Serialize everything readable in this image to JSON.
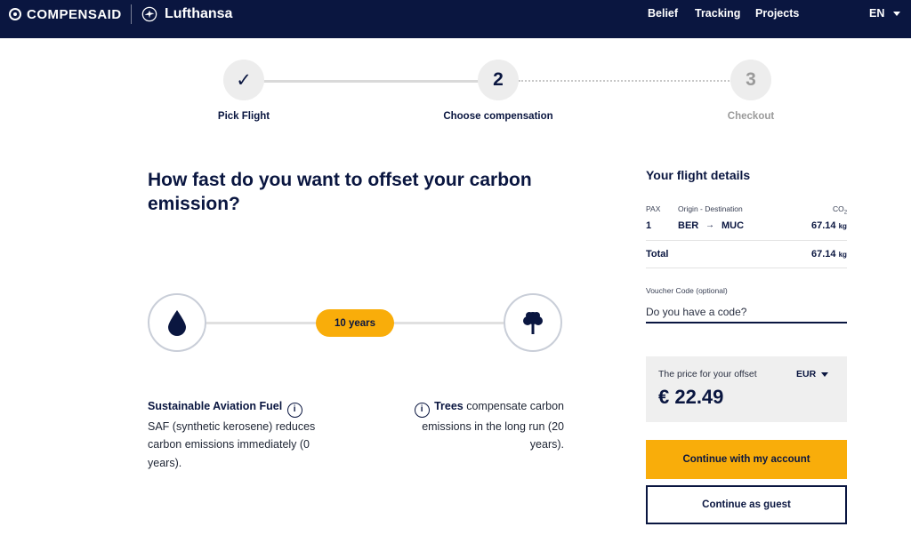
{
  "header": {
    "brand": "COMPENSAID",
    "partner": "Lufthansa",
    "nav": [
      "Belief",
      "Tracking",
      "Projects"
    ],
    "language": "EN"
  },
  "stepper": {
    "steps": [
      {
        "number": "✓",
        "label": "Pick Flight",
        "state": "done"
      },
      {
        "number": "2",
        "label": "Choose compensation",
        "state": "active"
      },
      {
        "number": "3",
        "label": "Checkout",
        "state": "pending"
      }
    ]
  },
  "main": {
    "question": "How fast do you want to offset your carbon emission?",
    "slider": {
      "value_label": "10 years",
      "left_icon": "drop-icon",
      "right_icon": "tree-icon"
    },
    "saf": {
      "title": "Sustainable Aviation Fuel",
      "body": "SAF (synthetic kerosene) reduces carbon emissions immediately (0 years)."
    },
    "trees": {
      "title": "Trees",
      "body": " compensate carbon emissions in the long run (20 years)."
    }
  },
  "flight_details": {
    "title": "Your flight details",
    "headers": {
      "pax": "PAX",
      "route": "Origin - Destination",
      "co2": "CO",
      "co2_sub": "2"
    },
    "row": {
      "pax": "1",
      "origin": "BER",
      "arrow": "→",
      "destination": "MUC",
      "co2_value": "67.14",
      "co2_unit": "kg"
    },
    "total": {
      "label": "Total",
      "co2_value": "67.14",
      "co2_unit": "kg"
    },
    "voucher": {
      "label": "Voucher Code (optional)",
      "placeholder": "Do you have a code?"
    },
    "price": {
      "label": "The price for your offset",
      "currency": "EUR",
      "value": "€ 22.49"
    },
    "buttons": {
      "primary": "Continue with my account",
      "secondary": "Continue as guest"
    }
  },
  "colors": {
    "navy": "#0a1640",
    "accent": "#f9ad0a"
  }
}
